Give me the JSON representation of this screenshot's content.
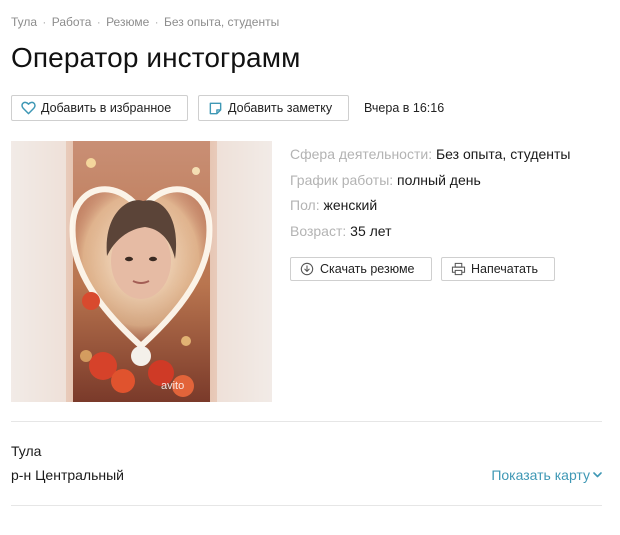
{
  "breadcrumb": {
    "items": [
      "Тула",
      "Работа",
      "Резюме",
      "Без опыта, студенты"
    ],
    "separator": "·"
  },
  "title": "Оператор инстограмм",
  "actions": {
    "favorite_label": "Добавить в избранное",
    "note_label": "Добавить заметку",
    "posted": "Вчера в 16:16"
  },
  "photo": {
    "watermark": "avito"
  },
  "details": [
    {
      "label": "Сфера деятельности:",
      "value": "Без опыта, студенты"
    },
    {
      "label": "График работы:",
      "value": "полный день"
    },
    {
      "label": "Пол:",
      "value": "женский"
    },
    {
      "label": "Возраст:",
      "value": "35 лет"
    }
  ],
  "resume_actions": {
    "download_label": "Скачать резюме",
    "print_label": "Напечатать"
  },
  "location": {
    "city": "Тула",
    "district": "р-н Центральный",
    "map_label": "Показать карту"
  },
  "colors": {
    "link": "#3f98b5",
    "heart_icon": "#3f98b5",
    "label_gray": "#b3b3b3"
  },
  "icons": {
    "favorite": "heart-icon",
    "note": "sticky-note-icon",
    "download": "download-icon",
    "print": "printer-icon",
    "map": "chevron-down-icon"
  }
}
